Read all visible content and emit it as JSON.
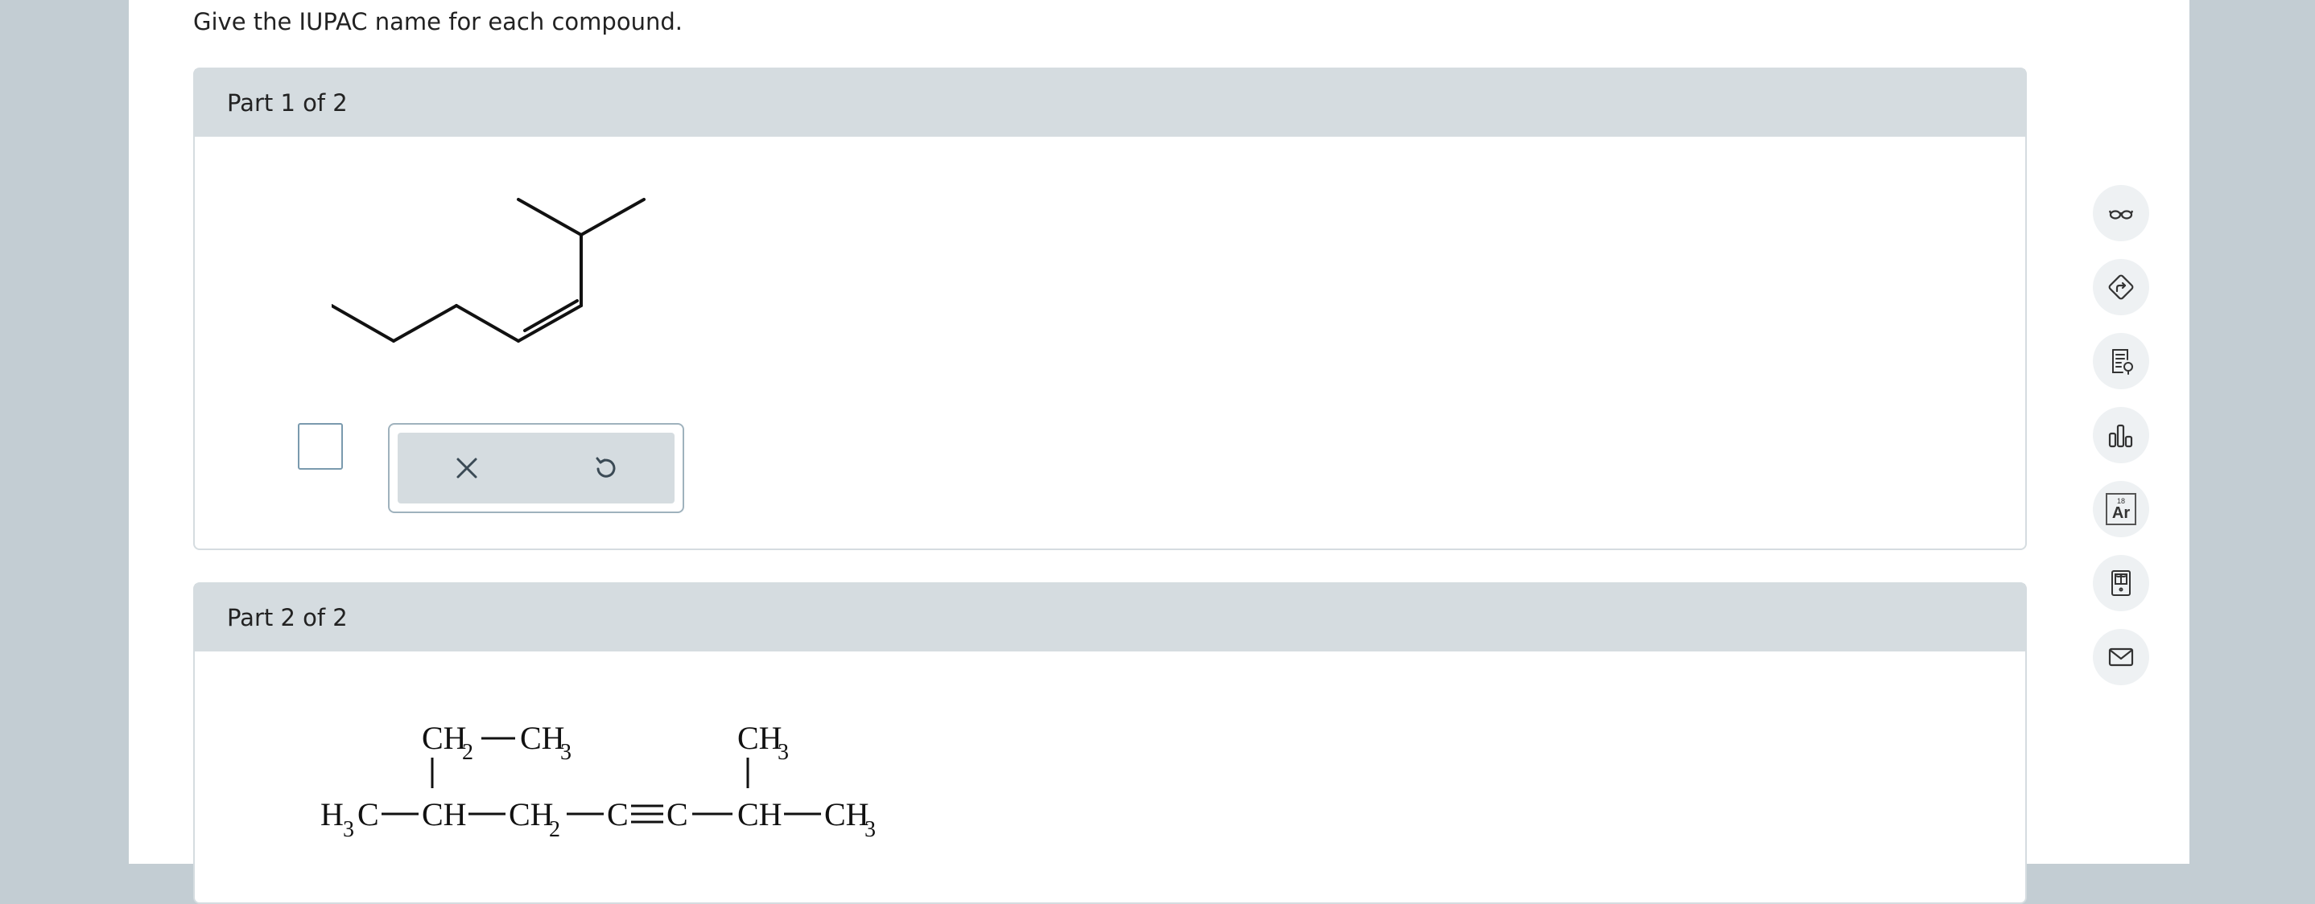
{
  "instructions": "Give the IUPAC name for each compound.",
  "parts": [
    {
      "label": "Part 1 of 2"
    },
    {
      "label": "Part 2 of 2"
    }
  ],
  "answer_tools": {
    "clear_icon": "close-icon",
    "undo_icon": "undo-icon"
  },
  "sidebar_icons": [
    "glasses-icon",
    "directions-icon",
    "notes-icon",
    "chart-icon",
    "periodic-table-icon",
    "calculator-book-icon",
    "mail-icon"
  ],
  "periodic_tile": {
    "number": "18",
    "symbol": "Ar"
  },
  "formula2": {
    "top_left_a": "CH",
    "top_left_a_sub": "2",
    "top_left_b": "CH",
    "top_left_b_sub": "3",
    "top_right": "CH",
    "top_right_sub": "3",
    "h3c_h": "H",
    "h3c_sub": "3",
    "h3c_c": "C",
    "ch1": "CH",
    "ch2": "CH",
    "ch2_sub": "2",
    "c1": "C",
    "triple": "≡",
    "c2": "C",
    "ch3": "CH",
    "ch3_end": "CH",
    "ch3_end_sub": "3"
  },
  "colors": {
    "panel_header": "#d5dce0",
    "backdrop": "#c3cdd3",
    "answer_border": "#7a9aae"
  }
}
